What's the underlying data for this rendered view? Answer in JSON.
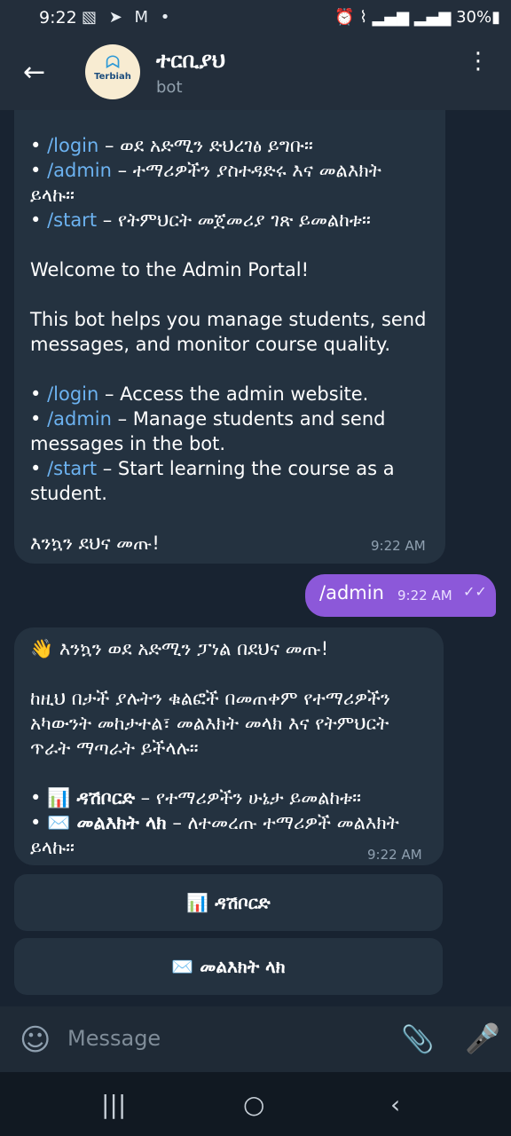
{
  "status": {
    "time": "9:22",
    "icons": "▧ ➤ M •",
    "right": "⏰ ⌇ ▂▄▆ ▂▄▆ 30%▮"
  },
  "header": {
    "back": "←",
    "title": "ተርቢያህ",
    "subtitle": "bot",
    "avatar_mark": "ᗣ",
    "avatar_text": "Terbiah",
    "menu": "⋮"
  },
  "top_message": {
    "lines1": [
      "/login",
      " – ወደ አድሚን ድህረገፅ ይግቡ።"
    ],
    "line2": [
      "/admin",
      " – ተማሪዎችን ያስተዳድሩ እና መልእክት"
    ],
    "line2b": "ይላኩ።",
    "line3": [
      "/start",
      " – የትምህርት መጀመሪያ ገጽ ይመልከቱ።"
    ],
    "welcome": "Welcome to the Admin Portal!",
    "desc": "This bot helps you manage students, send messages, and monitor course quality.",
    "e1": [
      "/login",
      " – Access the admin website."
    ],
    "e2": [
      "/admin",
      " – Manage students and send messages in the bot."
    ],
    "e3": [
      "/start",
      " – Start learning the course as a student."
    ],
    "footer": "እንኳን ደህና መጡ!",
    "time": "9:22 AM"
  },
  "out_message": {
    "text": "/admin",
    "time": "9:22 AM",
    "check": "✓✓"
  },
  "mid_message": {
    "p1": "👋 እንኳን ወደ አድሚን ፓነል በደህና መጡ!",
    "p2": "ከዚህ በታች ያሉትን ቁልፎች በመጠቀም የተማሪዎችን አካውንት መከታተል፣ መልእክት መላክ እና የትምህርት ጥራት ማጣራት ይችላሉ።",
    "b1": "📊 ዳሽቦርድ",
    "b1rest": " – የተማሪዎችን ሁኔታ ይመልከቱ።",
    "b2": "✉️ መልእክት ላክ",
    "b2rest": " – ለተመረጡ ተማሪዎች መልእክት ይላኩ።",
    "time": "9:22 AM"
  },
  "buttons": {
    "dashboard": "📊 ዳሽቦርድ",
    "send": "✉️ መልእክት ላክ"
  },
  "composer": {
    "placeholder": "Message",
    "emoji": "☺",
    "attach": "📎",
    "mic": "🎤"
  },
  "nav": {
    "recent": "|||",
    "home": "○",
    "back": "‹"
  }
}
